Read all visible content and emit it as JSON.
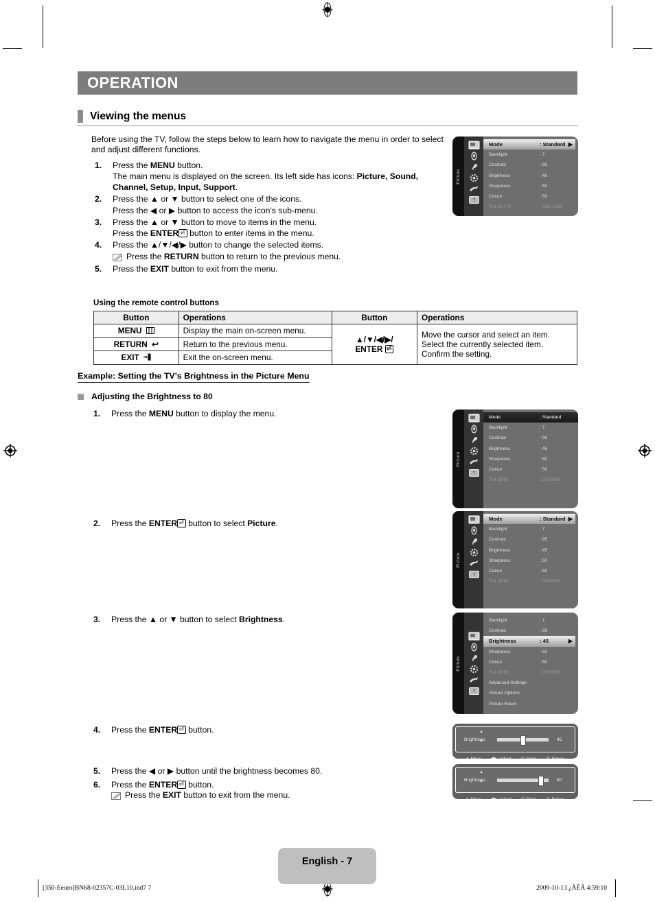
{
  "header": {
    "title": "OPERATION"
  },
  "section": {
    "title": "Viewing the menus"
  },
  "intro": "Before using the TV, follow the steps below to learn how to navigate the menu in order to select and adjust different functions.",
  "steps": [
    {
      "num": "1.",
      "main_pre": "Press the ",
      "main_b": "MENU",
      "main_post": " button.",
      "sub1_a": "The main menu is displayed on the screen. Its left side has icons: ",
      "sub1_b1": "Picture, Sound, Channel, Setup, Input, Support",
      "sub1_c": "."
    },
    {
      "num": "2.",
      "line1": "Press the ▲ or ▼ button to select one of the icons.",
      "line2": "Press the ◀ or ▶ button to access the icon's sub-menu."
    },
    {
      "num": "3.",
      "line1": "Press the ▲ or ▼ button to move to items in the menu.",
      "line2_pre": "Press the ",
      "line2_b": "ENTER",
      "line2_post": " button to enter items in the menu."
    },
    {
      "num": "4.",
      "line1": "Press the ▲/▼/◀/▶ button to change the selected items.",
      "note_pre": "Press the ",
      "note_b": "RETURN",
      "note_post": " button to return to the previous menu."
    },
    {
      "num": "5.",
      "line1_pre": "Press the ",
      "line1_b": "EXIT",
      "line1_post": " button to exit from the menu."
    }
  ],
  "remote_table": {
    "caption": "Using the remote control buttons",
    "headers": [
      "Button",
      "Operations",
      "Button",
      "Operations"
    ],
    "left_rows": [
      {
        "button": "MENU",
        "button_icon": "menu-icon",
        "operation": "Display the main on-screen menu."
      },
      {
        "button": "RETURN",
        "button_icon": "return-arrow-icon",
        "operation": "Return to the previous menu."
      },
      {
        "button": "EXIT",
        "button_icon": "exit-door-icon",
        "operation": "Exit the on-screen menu."
      }
    ],
    "right_button_line1": "▲/▼/◀/▶/",
    "right_button_line2": "ENTER",
    "right_operations": [
      "Move the cursor and select an item.",
      "Select the currently selected item.",
      "Confirm the setting."
    ]
  },
  "example": {
    "heading": "Example: Setting the TV's Brightness in the Picture Menu",
    "bullet_heading": "Adjusting the Brightness to 80",
    "steps": [
      {
        "num": "1.",
        "pre": "Press the ",
        "b": "MENU",
        "post": " button to display the menu."
      },
      {
        "num": "2.",
        "pre": "Press the ",
        "b": "ENTER",
        "mid": " button to select ",
        "b2": "Picture",
        "post": "."
      },
      {
        "num": "3.",
        "pre": "Press the ▲ or ▼ button to select ",
        "b2": "Brightness",
        "post": "."
      },
      {
        "num": "4.",
        "pre": "Press the ",
        "b": "ENTER",
        "post": " button."
      },
      {
        "num": "5.",
        "pre": "Press the ◀ or ▶ button until the brightness becomes 80."
      },
      {
        "num": "6.",
        "pre": "Press the ",
        "b": "ENTER",
        "post": " button."
      }
    ],
    "note6_pre": "Press the ",
    "note6_b": "EXIT",
    "note6_post": " button to exit from the menu."
  },
  "osd": {
    "rail_label": "Picture",
    "icons": [
      "picture-icon",
      "sound-icon",
      "channel-icon",
      "setup-icon",
      "input-icon",
      "support-icon"
    ],
    "panel1": {
      "rows": [
        {
          "label": "Mode",
          "value": ": Standard",
          "state": "highlight",
          "arrow": "▶"
        },
        {
          "label": "Backlight",
          "value": ": 7",
          "state": "normal"
        },
        {
          "label": "Contrast",
          "value": ": 95",
          "state": "normal"
        },
        {
          "label": "Brightness",
          "value": ": 45",
          "state": "normal"
        },
        {
          "label": "Sharpness",
          "value": ": 50",
          "state": "normal"
        },
        {
          "label": "Colour",
          "value": ": 50",
          "state": "normal"
        },
        {
          "label": "Tint (G / R)",
          "value": ": G50 / R50",
          "state": "dim"
        }
      ]
    },
    "panel2": {
      "rows": [
        {
          "label": "Mode",
          "value": ": Standard",
          "state": "bar"
        },
        {
          "label": "Backlight",
          "value": ": 7",
          "state": "normal"
        },
        {
          "label": "Contrast",
          "value": ": 95",
          "state": "normal"
        },
        {
          "label": "Brightness",
          "value": ": 45",
          "state": "normal"
        },
        {
          "label": "Sharpness",
          "value": ": 50",
          "state": "normal"
        },
        {
          "label": "Colour",
          "value": ": 50",
          "state": "normal"
        },
        {
          "label": "Tint (G/R)",
          "value": ": G50/R50",
          "state": "dim"
        }
      ]
    },
    "panel3": {
      "rows": [
        {
          "label": "Mode",
          "value": ": Standard",
          "state": "highlight",
          "arrow": "▶"
        },
        {
          "label": "Backlight",
          "value": ": 7",
          "state": "normal"
        },
        {
          "label": "Contrast",
          "value": ": 95",
          "state": "normal"
        },
        {
          "label": "Brightness",
          "value": ": 45",
          "state": "normal"
        },
        {
          "label": "Sharpness",
          "value": ": 50",
          "state": "normal"
        },
        {
          "label": "Colour",
          "value": ": 50",
          "state": "normal"
        },
        {
          "label": "Tint (G/R)",
          "value": ": G50/R50",
          "state": "dim"
        }
      ]
    },
    "panel4": {
      "rows": [
        {
          "label": "Backlight",
          "value": ": 7",
          "state": "normal"
        },
        {
          "label": "Contrast",
          "value": ": 95",
          "state": "normal"
        },
        {
          "label": "Brightness",
          "value": ": 45",
          "state": "highlight",
          "arrow": "▶"
        },
        {
          "label": "Sharpness",
          "value": ": 50",
          "state": "normal"
        },
        {
          "label": "Colour",
          "value": ": 50",
          "state": "normal"
        },
        {
          "label": "Tint (G/R)",
          "value": ": G50/R50",
          "state": "dim"
        },
        {
          "label": "Advanced Settings",
          "value": "",
          "state": "normal"
        },
        {
          "label": "Picture Options",
          "value": "",
          "state": "normal"
        },
        {
          "label": "Picture Reset",
          "value": "",
          "state": "normal"
        }
      ]
    },
    "slider1": {
      "name": "Brightness",
      "value": "45",
      "percent": 45
    },
    "slider2": {
      "name": "Brightness",
      "value": "80",
      "percent": 80
    },
    "slider_footer": [
      {
        "key": "♦",
        "label": "Move"
      },
      {
        "key": "◀▶",
        "label": "Adjust"
      },
      {
        "key": "⏎",
        "label": "Enter"
      },
      {
        "key": "↺",
        "label": "Return"
      }
    ]
  },
  "footer": {
    "page_label": "English - 7",
    "left": "[350-Eeuro]BN68-02357C-03L10.ind7   7",
    "right": "2009-10-13   ¿ÀÈÄ 4:59:10"
  },
  "colors": {
    "banner": "#7d7d7d",
    "accent_bar": "#8c8c8c",
    "page_badge": "#bfbfbf",
    "osd_bg": "#6e6e6e"
  }
}
